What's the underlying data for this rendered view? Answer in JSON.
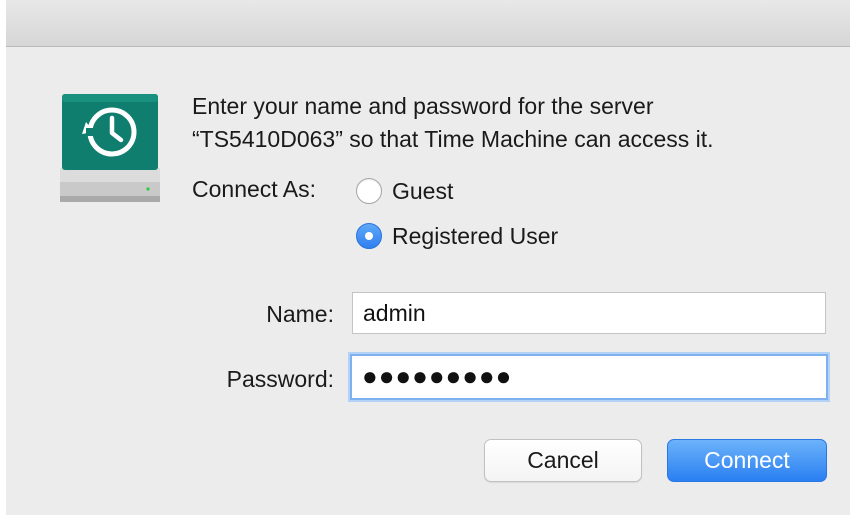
{
  "dialog": {
    "message_line1": "Enter your name and password for the server",
    "message_line2": "“TS5410D063” so that Time Machine can access it.",
    "icon": "time-machine-drive-icon"
  },
  "connect_as": {
    "label": "Connect As:",
    "options": [
      {
        "label": "Guest",
        "selected": false
      },
      {
        "label": "Registered User",
        "selected": true
      }
    ]
  },
  "fields": {
    "name_label": "Name:",
    "name_value": "admin",
    "password_label": "Password:",
    "password_value": "●●●●●●●●●"
  },
  "buttons": {
    "cancel": "Cancel",
    "connect": "Connect"
  },
  "colors": {
    "accent": "#2f7ff0",
    "drive_teal": "#0f7e6e",
    "dialog_bg": "#ececec"
  }
}
